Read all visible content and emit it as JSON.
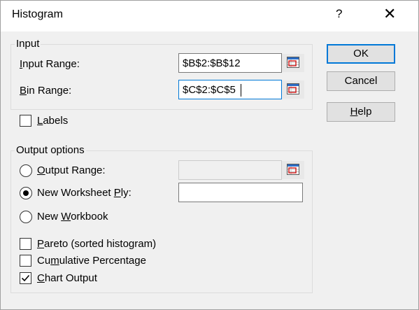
{
  "window": {
    "title": "Histogram",
    "help_glyph": "?",
    "close_glyph": "✕"
  },
  "input_group": {
    "label": "Input",
    "input_range_label_u": "I",
    "input_range_label_rest": "nput Range:",
    "input_range_value": "$B$2:$B$12",
    "bin_range_label_u": "B",
    "bin_range_label_rest": "in Range:",
    "bin_range_value": "$C$2:$C$5"
  },
  "labels_checkbox": {
    "label_u": "L",
    "label_rest": "abels",
    "checked": false
  },
  "output_group": {
    "label": "Output options",
    "output_range_u": "O",
    "output_range_rest": "utput Range:",
    "output_range_value": "",
    "new_ply_pre": "New Worksheet ",
    "new_ply_u": "P",
    "new_ply_rest": "ly:",
    "new_ply_value": "",
    "new_workbook_pre": "New ",
    "new_workbook_u": "W",
    "new_workbook_rest": "orkbook",
    "selected": "new_worksheet_ply"
  },
  "options": {
    "pareto_u": "P",
    "pareto_rest": "areto (sorted histogram)",
    "pareto_checked": false,
    "cumulative_pre": "Cu",
    "cumulative_u": "m",
    "cumulative_rest": "ulative Percentage",
    "cumulative_checked": false,
    "chart_u": "C",
    "chart_rest": "hart Output",
    "chart_checked": true
  },
  "buttons": {
    "ok": "OK",
    "cancel": "Cancel",
    "help_u": "H",
    "help_rest": "elp"
  },
  "icons": {
    "refedit": "collapse-dialog-icon",
    "checkmark": "checkmark-icon"
  }
}
